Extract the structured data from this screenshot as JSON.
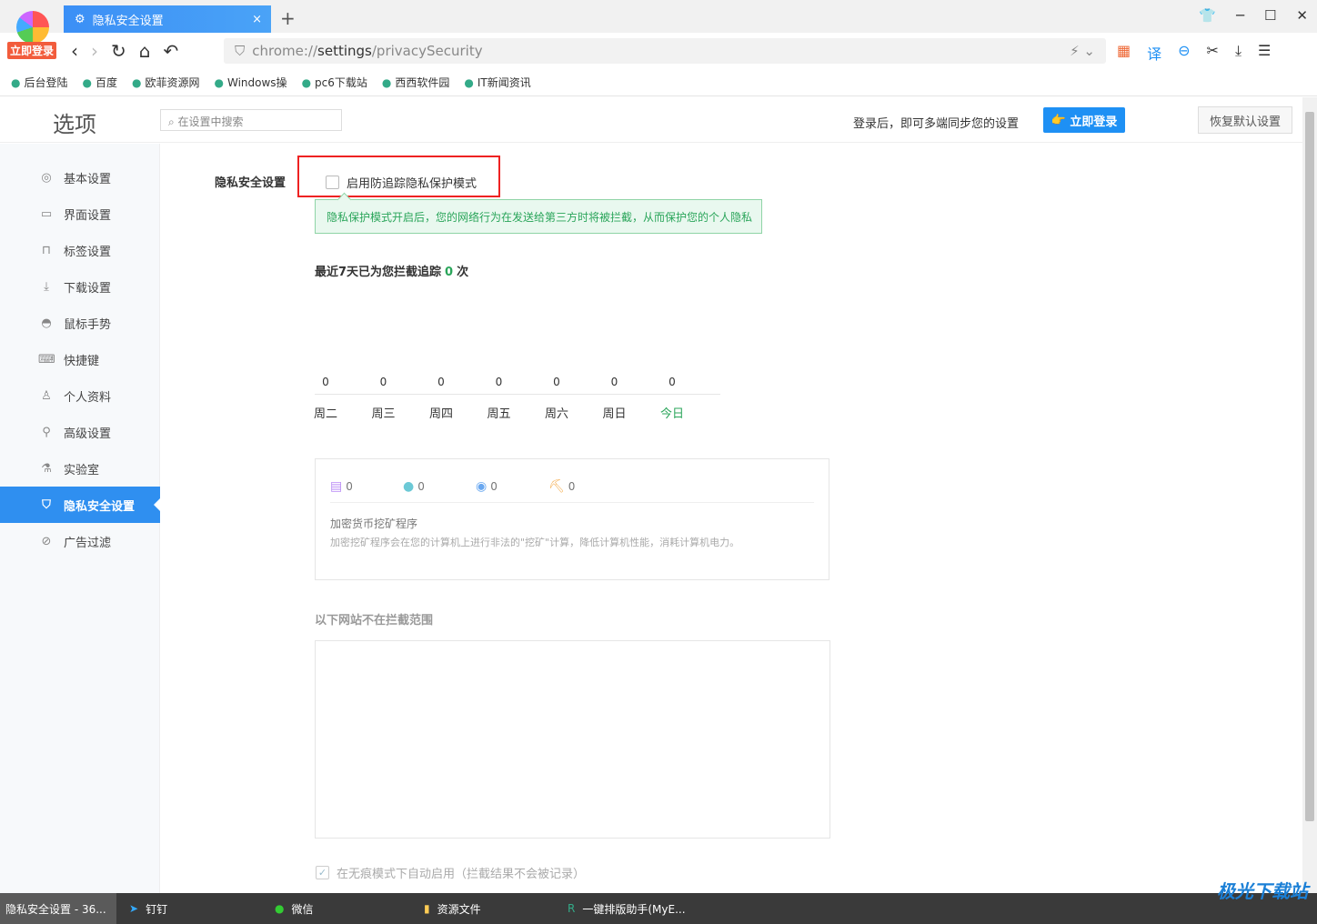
{
  "browser": {
    "login_badge": "立即登录",
    "tab_title": "隐私安全设置",
    "url_prefix": "chrome://",
    "url_host": "settings",
    "url_path": "/privacySecurity"
  },
  "bookmarks": [
    "后台登陆",
    "百度",
    "欧菲资源网",
    "Windows操",
    "pc6下载站",
    "西西软件园",
    "IT新闻资讯"
  ],
  "header": {
    "title": "选项",
    "search_placeholder": "在设置中搜索",
    "sync_text": "登录后，即可多端同步您的设置",
    "login_button": "立即登录",
    "restore_button": "恢复默认设置"
  },
  "sidebar": {
    "items": [
      {
        "label": "基本设置",
        "icon": "target-icon"
      },
      {
        "label": "界面设置",
        "icon": "window-icon"
      },
      {
        "label": "标签设置",
        "icon": "tab-icon"
      },
      {
        "label": "下载设置",
        "icon": "download-icon"
      },
      {
        "label": "鼠标手势",
        "icon": "mouse-icon"
      },
      {
        "label": "快捷键",
        "icon": "keyboard-icon"
      },
      {
        "label": "个人资料",
        "icon": "user-icon"
      },
      {
        "label": "高级设置",
        "icon": "wrench-icon"
      },
      {
        "label": "实验室",
        "icon": "flask-icon"
      },
      {
        "label": "隐私安全设置",
        "icon": "shield-icon",
        "active": true
      },
      {
        "label": "广告过滤",
        "icon": "block-icon"
      }
    ]
  },
  "privacy": {
    "section_label": "隐私安全设置",
    "toggle_label": "启用防追踪隐私保护模式",
    "toggle_checked": false,
    "tip": "隐私保护模式开启后，您的网络行为在发送给第三方时将被拦截，从而保护您的个人隐私",
    "stat_prefix": "最近7天已为您拦截追踪",
    "stat_count": "0",
    "stat_suffix": "次",
    "chart_data": {
      "type": "bar",
      "categories": [
        "周二",
        "周三",
        "周四",
        "周五",
        "周六",
        "周日",
        "今日"
      ],
      "values": [
        0,
        0,
        0,
        0,
        0,
        0,
        0
      ],
      "highlight": "今日",
      "highlight_color": "#2aa55a"
    },
    "counters": [
      {
        "icon": "message-icon",
        "value": "0",
        "color": "#b98cf5"
      },
      {
        "icon": "cookie-icon",
        "value": "0",
        "color": "#6cc9d6"
      },
      {
        "icon": "fingerprint-icon",
        "value": "0",
        "color": "#6aa8f0"
      },
      {
        "icon": "miner-icon",
        "value": "0",
        "color": "#f5b25a"
      }
    ],
    "card_title": "加密货币挖矿程序",
    "card_desc": "加密挖矿程序会在您的计算机上进行非法的\"挖矿\"计算，降低计算机性能，消耗计算机电力。",
    "exclusion_title": "以下网站不在拦截范围",
    "incognito_label": "在无痕模式下自动启用（拦截结果不会被记录）",
    "incognito_checked": true
  },
  "taskbar": {
    "items": [
      "隐私安全设置 - 36...",
      "钉钉",
      "微信",
      "资源文件",
      "一键排版助手(MyE..."
    ],
    "watermark": "极光下载站"
  }
}
